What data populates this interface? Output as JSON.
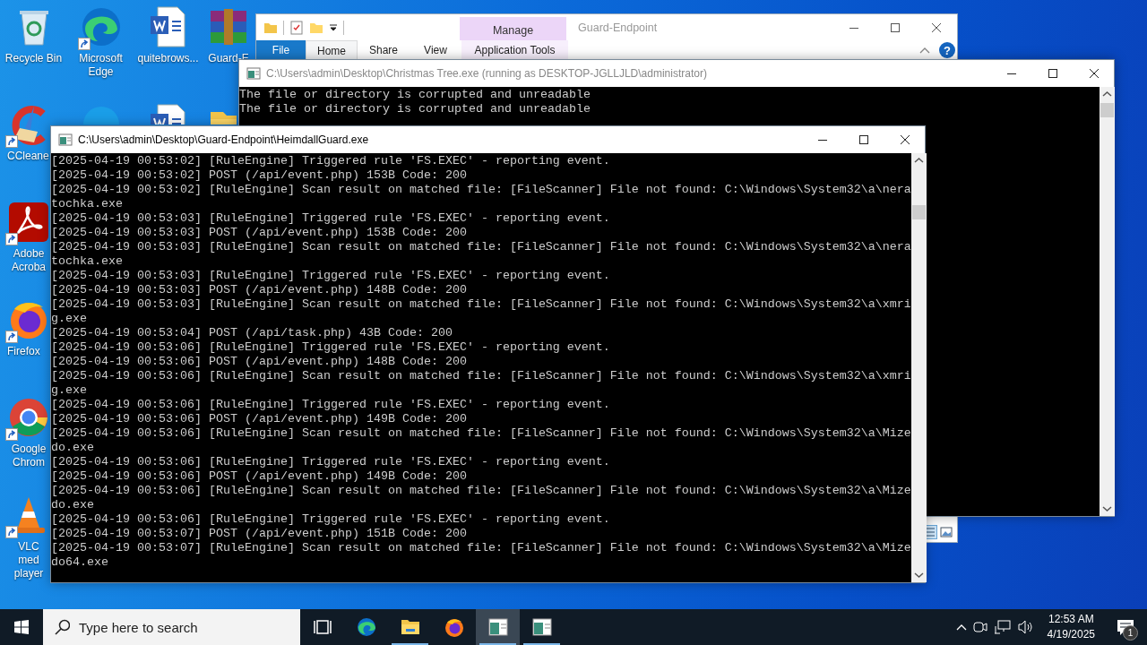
{
  "desktop": {
    "icon_columns": [
      [
        {
          "kind": "recycle-bin",
          "label": "Recycle Bin",
          "shortcut": false
        },
        {
          "kind": "ccleaner",
          "label": "CCleane",
          "shortcut": true
        },
        {
          "kind": "acrobat",
          "label": "Adobe Acroba",
          "shortcut": true
        },
        {
          "kind": "firefox",
          "label": "Firefox",
          "shortcut": true
        },
        {
          "kind": "chrome",
          "label": "Google Chrom",
          "shortcut": true
        },
        {
          "kind": "vlc",
          "label": "VLC med player",
          "shortcut": true
        }
      ],
      [
        {
          "kind": "edge",
          "label": "Microsoft Edge",
          "shortcut": true
        },
        {
          "kind": "skype",
          "shortcut": false
        }
      ],
      [
        {
          "kind": "word",
          "label": "quitebrows...",
          "shortcut": false
        },
        {
          "kind": "word",
          "shortcut": false
        }
      ],
      [
        {
          "kind": "winrar",
          "label": "Guard-E",
          "shortcut": false
        },
        {
          "kind": "folder",
          "shortcut": false
        }
      ]
    ]
  },
  "explorer": {
    "title": "Guard-Endpoint",
    "context_tab": "Manage",
    "help": "?",
    "tabs": [
      {
        "kind": "file",
        "label": "File",
        "selected": false
      },
      {
        "kind": "tab",
        "label": "Home",
        "selected": true
      },
      {
        "kind": "tab",
        "label": "Share",
        "selected": false
      },
      {
        "kind": "tab",
        "label": "View",
        "selected": false
      },
      {
        "kind": "context",
        "label": "Application Tools",
        "selected": false
      }
    ]
  },
  "christmas_console": {
    "title": "C:\\Users\\admin\\Desktop\\Christmas Tree.exe (running as DESKTOP-JGLLJLD\\administrator)",
    "lines": [
      "The file or directory is corrupted and unreadable",
      "The file or directory is corrupted and unreadable"
    ]
  },
  "heimdall_console": {
    "title": "C:\\Users\\admin\\Desktop\\Guard-Endpoint\\HeimdallGuard.exe",
    "lines": [
      "[2025-04-19 00:53:02] [RuleEngine] Triggered rule 'FS.EXEC' - reporting event.",
      "[2025-04-19 00:53:02] POST (/api/event.php) 153B Code: 200",
      "[2025-04-19 00:53:02] [RuleEngine] Scan result on matched file: [FileScanner] File not found: C:\\Windows\\System32\\a\\neratochka.exe",
      "[2025-04-19 00:53:03] [RuleEngine] Triggered rule 'FS.EXEC' - reporting event.",
      "[2025-04-19 00:53:03] POST (/api/event.php) 153B Code: 200",
      "[2025-04-19 00:53:03] [RuleEngine] Scan result on matched file: [FileScanner] File not found: C:\\Windows\\System32\\a\\neratochka.exe",
      "[2025-04-19 00:53:03] [RuleEngine] Triggered rule 'FS.EXEC' - reporting event.",
      "[2025-04-19 00:53:03] POST (/api/event.php) 148B Code: 200",
      "[2025-04-19 00:53:03] [RuleEngine] Scan result on matched file: [FileScanner] File not found: C:\\Windows\\System32\\a\\xmrig.exe",
      "[2025-04-19 00:53:04] POST (/api/task.php) 43B Code: 200",
      "[2025-04-19 00:53:06] [RuleEngine] Triggered rule 'FS.EXEC' - reporting event.",
      "[2025-04-19 00:53:06] POST (/api/event.php) 148B Code: 200",
      "[2025-04-19 00:53:06] [RuleEngine] Scan result on matched file: [FileScanner] File not found: C:\\Windows\\System32\\a\\xmrig.exe",
      "[2025-04-19 00:53:06] [RuleEngine] Triggered rule 'FS.EXEC' - reporting event.",
      "[2025-04-19 00:53:06] POST (/api/event.php) 149B Code: 200",
      "[2025-04-19 00:53:06] [RuleEngine] Scan result on matched file: [FileScanner] File not found: C:\\Windows\\System32\\a\\Mizedo.exe",
      "[2025-04-19 00:53:06] [RuleEngine] Triggered rule 'FS.EXEC' - reporting event.",
      "[2025-04-19 00:53:06] POST (/api/event.php) 149B Code: 200",
      "[2025-04-19 00:53:06] [RuleEngine] Scan result on matched file: [FileScanner] File not found: C:\\Windows\\System32\\a\\Mizedo.exe",
      "[2025-04-19 00:53:06] [RuleEngine] Triggered rule 'FS.EXEC' - reporting event.",
      "[2025-04-19 00:53:07] POST (/api/event.php) 151B Code: 200",
      "[2025-04-19 00:53:07] [RuleEngine] Scan result on matched file: [FileScanner] File not found: C:\\Windows\\System32\\a\\Mizedo64.exe"
    ]
  },
  "taskbar": {
    "search_placeholder": "Type here to search",
    "apps": [
      {
        "kind": "task-view",
        "running": false,
        "selected": false
      },
      {
        "kind": "edge",
        "running": false,
        "selected": false
      },
      {
        "kind": "folder",
        "running": true,
        "selected": false
      },
      {
        "kind": "firefox",
        "running": false,
        "selected": false
      },
      {
        "kind": "console",
        "running": true,
        "selected": true
      },
      {
        "kind": "console",
        "running": true,
        "selected": false
      }
    ],
    "clock": {
      "time": "12:53 AM",
      "date": "4/19/2025"
    },
    "notification_count": "1"
  }
}
